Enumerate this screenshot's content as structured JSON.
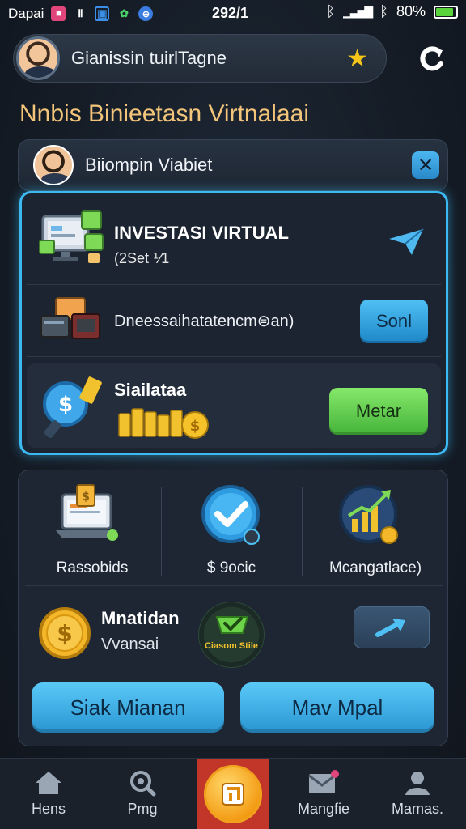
{
  "status_bar": {
    "carrier": "Dapai",
    "time": "292/1",
    "battery_percent": "80%",
    "battery_level": 0.8,
    "icons": [
      "notification-icon",
      "nfc-icon",
      "gallery-icon",
      "leaf-icon",
      "globe-icon",
      "bluetooth-icon",
      "signal-icon",
      "bluetooth-icon",
      "battery-icon"
    ]
  },
  "header": {
    "title": "Gianissin tuirlTagne",
    "star_icon": "star-icon",
    "refresh_icon": "refresh-icon"
  },
  "page_title": "Nnbis Binieetasn Virtnalaai",
  "profile": {
    "name": "Biiompin Viabiet",
    "close_icon": "close-icon"
  },
  "invest": {
    "title": "INVESTASI VIRTUAL",
    "subtitle": "(2Set ⅟1",
    "row2_label": "Dneessaihatatencm⊜an)",
    "row2_button": "Sonl",
    "row3_label": "Siailataa",
    "row3_button": "Metar"
  },
  "tiles": [
    {
      "label": "Rassobids",
      "icon": "laptop-icon"
    },
    {
      "label": "$ 9ocic",
      "icon": "check-icon"
    },
    {
      "label": "Mcangatlace)",
      "icon": "growth-chart-icon"
    }
  ],
  "mutasi": {
    "title": "Mnatidan",
    "subtitle": "Vvansai",
    "badge": "Ciasom Stile"
  },
  "cta": {
    "left": "Siak Mianan",
    "right": "Mav Mpal"
  },
  "nav": [
    {
      "label": "Hens",
      "icon": "home-icon"
    },
    {
      "label": "Pmg",
      "icon": "search-icon"
    },
    {
      "label": "",
      "icon": "center-coin-icon"
    },
    {
      "label": "Mangfie",
      "icon": "mail-icon"
    },
    {
      "label": "Mamas.",
      "icon": "user-icon"
    }
  ],
  "colors": {
    "accent_blue": "#3bb9f0",
    "accent_green": "#44b33a",
    "title_gold": "#f3c57a",
    "nav_center": "#c2362a"
  }
}
